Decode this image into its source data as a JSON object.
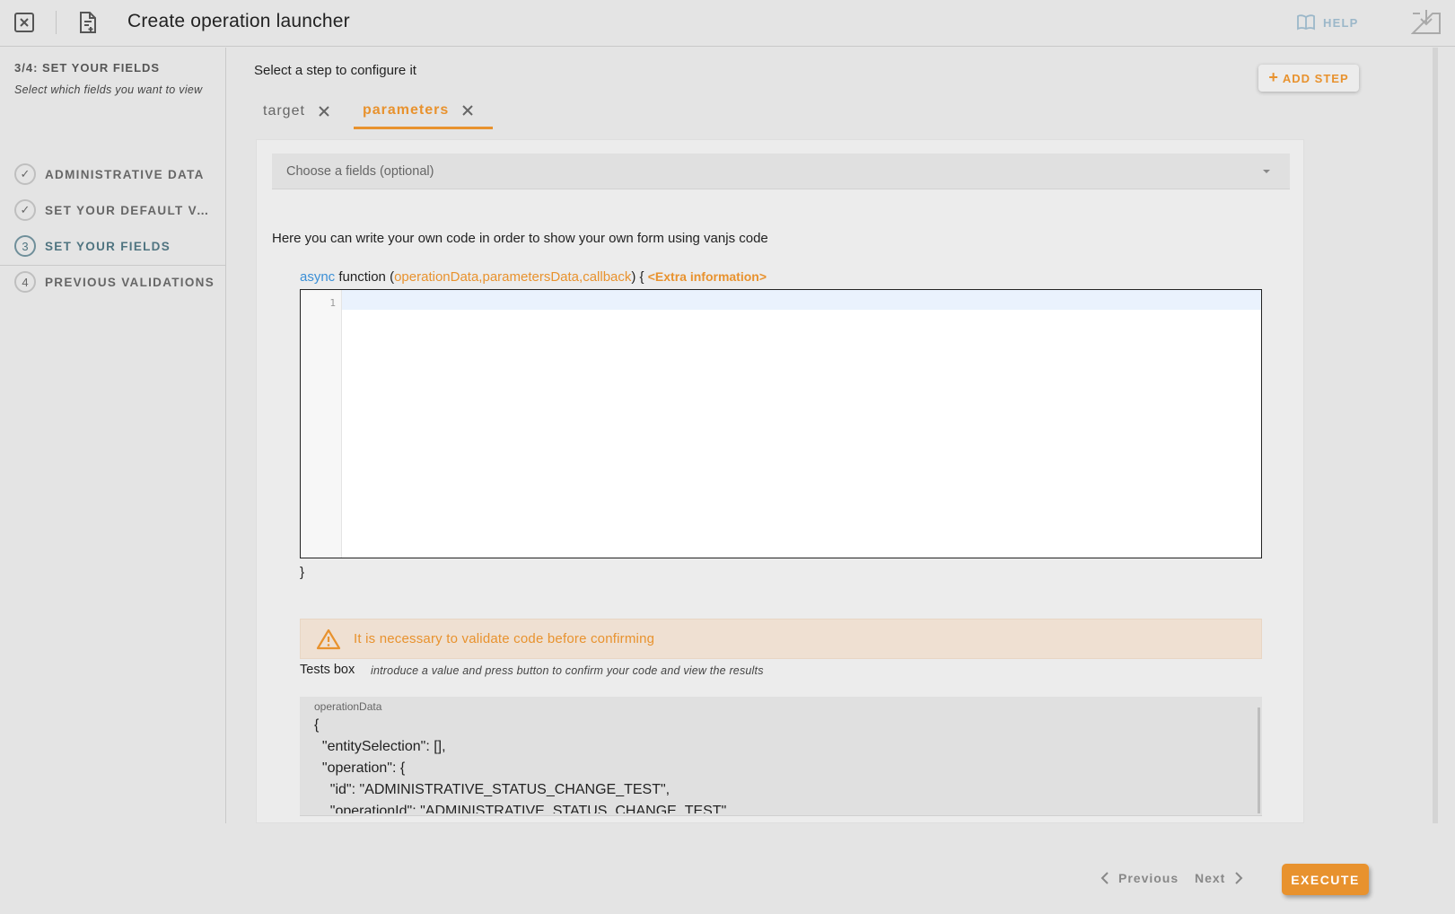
{
  "header": {
    "title": "Create operation launcher",
    "help_label": "HELP"
  },
  "sidebar": {
    "step_heading": "3/4: SET YOUR FIELDS",
    "step_subtitle": "Select which fields you want to view",
    "steps": [
      {
        "label": "ADMINISTRATIVE DATA",
        "state": "done",
        "marker": "✓"
      },
      {
        "label": "SET YOUR DEFAULT VALUES",
        "state": "done",
        "marker": "✓"
      },
      {
        "label": "SET YOUR FIELDS",
        "state": "active",
        "marker": "3"
      },
      {
        "label": "PREVIOUS VALIDATIONS",
        "state": "pending",
        "marker": "4"
      }
    ]
  },
  "main": {
    "select_step_text": "Select a step to configure it",
    "add_step_label": "ADD STEP",
    "tabs": [
      {
        "label": "target",
        "active": false
      },
      {
        "label": "parameters",
        "active": true
      }
    ],
    "fields_dropdown": {
      "placeholder": "Choose a fields (optional)"
    },
    "description": "Here you can write your own code in order to show your own form using vanjs code",
    "signature": {
      "keyword": "async",
      "func": "function",
      "open_paren": "(",
      "args": "operationData,parametersData,callback",
      "close": ") {",
      "extra": "<Extra information>"
    },
    "editor": {
      "line_number": "1",
      "code": ""
    },
    "closing_brace": "}",
    "warning": "It is necessary to validate code before confirming",
    "tests": {
      "label": "Tests box",
      "hint": "introduce a value and press button to confirm your code and view the results",
      "field_label": "operationData",
      "value": "{\n  \"entitySelection\": [],\n  \"operation\": {\n    \"id\": \"ADMINISTRATIVE_STATUS_CHANGE_TEST\",\n    \"operationId\": \"ADMINISTRATIVE_STATUS_CHANGE_TEST\","
    }
  },
  "footer": {
    "previous_label": "Previous",
    "next_label": "Next",
    "execute_label": "EXECUTE"
  },
  "colors": {
    "accent": "#e8922e",
    "active_step": "#4f7480",
    "keyword_blue": "#3a8fd6",
    "warning_bg": "#efe0d2"
  }
}
